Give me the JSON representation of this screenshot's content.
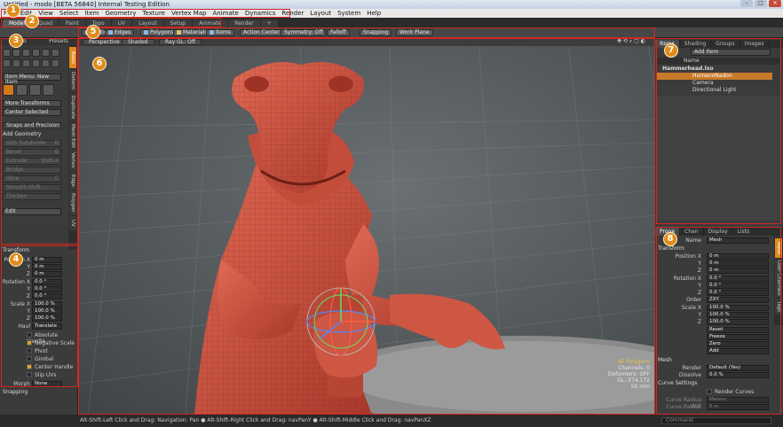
{
  "window": {
    "title": "Untitled - modo [BETA 56840] Internal Testing Edition"
  },
  "menu": [
    "File",
    "Edit",
    "View",
    "Select",
    "Item",
    "Geometry",
    "Texture",
    "Vertex Map",
    "Animate",
    "Dynamics",
    "Render",
    "Layout",
    "System",
    "Help"
  ],
  "layout_tabs": [
    "Model",
    "Quad",
    "Paint",
    "Topo",
    "UV",
    "Layout",
    "Setup",
    "Animate",
    "Render",
    "+"
  ],
  "toolbar": {
    "items": [
      "Vertices",
      "Edges",
      "Polygons",
      "Materials",
      "Items",
      "Action Center",
      "Symmetry: Off",
      "Falloff",
      "Snapping",
      "Work Plane"
    ]
  },
  "left_panel": {
    "top_tabs": [
      "Toolb",
      "Presets"
    ],
    "vertical_tabs": [
      "Basic",
      "Deform",
      "Duplicate",
      "Mesh Edit",
      "Vertex",
      "Edge",
      "Polygon",
      "UV"
    ],
    "item_menu": "Item Menu: New Item",
    "more_transforms": "More Transforms",
    "center_selected": "Center Selected",
    "snaps": "Snaps and Precision",
    "add_geometry": "Add Geometry",
    "geometry_tools": [
      "SDS Subdivide",
      "Bevel",
      "Extrude",
      "Bridge",
      "Slice",
      "Smooth Shift",
      "Thicken"
    ],
    "geometry_shortcuts": [
      "D",
      "B",
      "Shift-X",
      "",
      "C",
      "",
      ""
    ],
    "edit_drop": "Edit",
    "transform": {
      "section": "Transform",
      "position_label": "Position X",
      "axes": [
        "X",
        "Y",
        "Z"
      ],
      "position": [
        "0 m",
        "0 m",
        "0 m"
      ],
      "rotation_label": "Rotation X",
      "rotation": [
        "0.0 °",
        "0.0 °",
        "0.0 °"
      ],
      "scale_label": "Scale X",
      "scale": [
        "100.0 %",
        "100.0 %",
        "100.0 %"
      ],
      "haul_label": "Haul",
      "haul": "Translate",
      "checks": [
        {
          "label": "Absolute Handle",
          "on": false
        },
        {
          "label": "Negative Scale",
          "on": true
        },
        {
          "label": "Pivot",
          "on": false
        },
        {
          "label": "Gimbal",
          "on": false
        },
        {
          "label": "Center Handle",
          "on": true
        },
        {
          "label": "Slip UVs",
          "on": false
        }
      ],
      "morph_label": "Morph",
      "morph": "None",
      "snapping": "Snapping"
    }
  },
  "viewport": {
    "tabs": [
      "Perspective",
      "Shaded",
      "Ray GL: Off"
    ],
    "overlay": [
      "All Polygons",
      "Channels: 0",
      "Deformers: OFF",
      "GL: 274,172",
      "50 mm"
    ]
  },
  "statusbar": "Alt-Shift-Left Click and Drag: Navigation: Pan ● Alt-Shift-Right Click and Drag: navPanY ● Alt-Shift-Middle Click and Drag: navPanXZ",
  "items_panel": {
    "tabs": [
      "Items",
      "Shading",
      "Groups",
      "Images"
    ],
    "add_item": "Add Item",
    "col_name": "Name",
    "rows": [
      "Hammerhead.lxo",
      "HumanoNadon",
      "Camera",
      "Directional Light"
    ]
  },
  "properties_panel": {
    "tabs": [
      "Prope",
      "Chan",
      "Display",
      "Lists"
    ],
    "side_tabs": [
      "Mesh",
      "User Channels",
      "Tags"
    ],
    "name_label": "Name",
    "name_value": "Mesh",
    "transform": "Transform",
    "position_label": "Position X",
    "axes": [
      "X",
      "Y",
      "Z"
    ],
    "position": [
      "0 m",
      "0 m",
      "0 m"
    ],
    "rotation_label": "Rotation X",
    "rotation": [
      "0.0 °",
      "0.0 °",
      "0.0 °"
    ],
    "order_label": "Order",
    "order": "ZXY",
    "scale_label": "Scale X",
    "scale": [
      "100.0 %",
      "100.0 %",
      "100.0 %"
    ],
    "actions": [
      "Reset",
      "Freeze",
      "Zero",
      "Add"
    ],
    "mesh": "Mesh",
    "render_label": "Render",
    "render": "Default (Yes)",
    "dissolve_label": "Dissolve",
    "dissolve": "0.0 %",
    "curve_settings": "Curve Settings",
    "render_curves": "Render Curves",
    "curve_radius_unit_label": "Curve Radius Unit",
    "curve_radius_unit": "Meters",
    "curve_radius_label": "Curve Radius",
    "curve_radius": "0 m",
    "command": "Command"
  },
  "annotations": [
    "1",
    "2",
    "3",
    "4",
    "5",
    "6",
    "7",
    "8"
  ],
  "colors": {
    "accent": "#e08c1a",
    "highlight_red": "#d4261e",
    "model_skin": "#c8503e"
  }
}
